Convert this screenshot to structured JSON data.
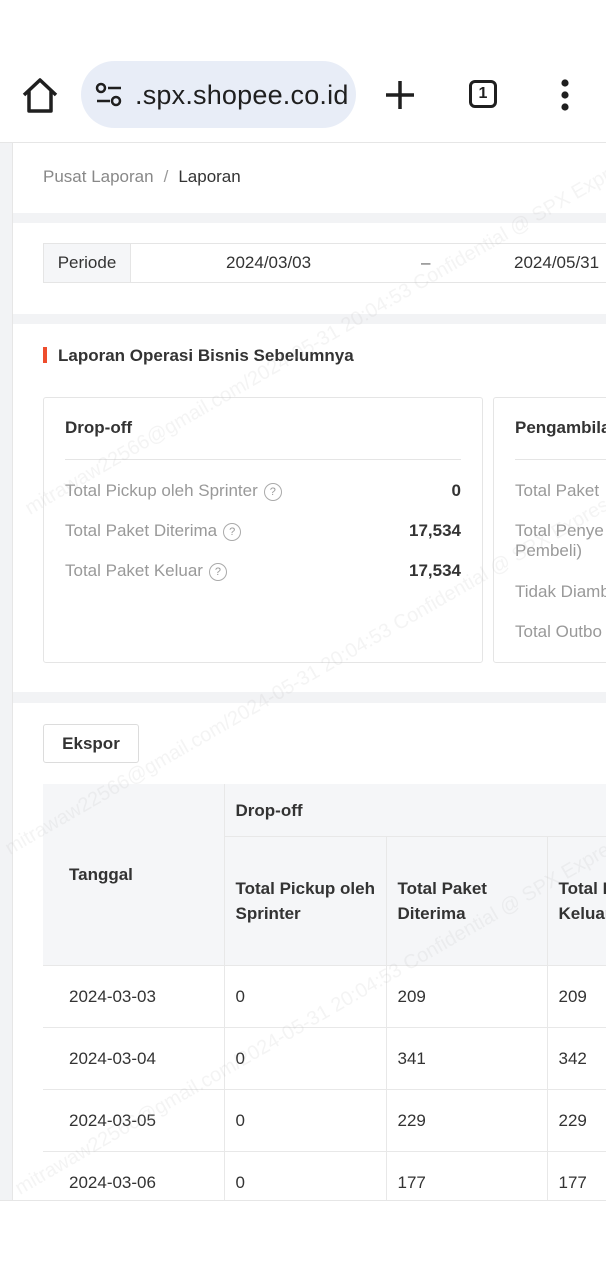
{
  "browser": {
    "url": ".spx.shopee.co.id",
    "tab_count": "1"
  },
  "breadcrumb": {
    "parent": "Pusat Laporan",
    "separator": "/",
    "current": "Laporan"
  },
  "period": {
    "label": "Periode",
    "start": "2024/03/03",
    "dash": "–",
    "end": "2024/05/31"
  },
  "section_title": "Laporan Operasi Bisnis Sebelumnya",
  "dropoff_card": {
    "title": "Drop-off",
    "rows": [
      {
        "label": "Total Pickup oleh Sprinter",
        "value": "0"
      },
      {
        "label": "Total Paket Diterima",
        "value": "17,534"
      },
      {
        "label": "Total Paket Keluar",
        "value": "17,534"
      }
    ]
  },
  "pickup_card": {
    "title": "Pengambila",
    "rows": [
      {
        "label": "Total Paket"
      },
      {
        "label": "Total Penye"
      },
      {
        "label": "Pembeli)"
      },
      {
        "label": "Tidak Diamb"
      },
      {
        "label": "Total Outbo"
      }
    ]
  },
  "export_label": "Ekspor",
  "table": {
    "date_header": "Tanggal",
    "group_header": "Drop-off",
    "col_pickup_line1": "Total Pickup oleh",
    "col_pickup_line2": "Sprinter",
    "col_received_line1": "Total Paket",
    "col_received_line2": "Diterima",
    "col_out_line1": "Total P",
    "col_out_line2": "Keluar",
    "rows": [
      {
        "date": "2024-03-03",
        "pickup": "0",
        "received": "209",
        "out": "209"
      },
      {
        "date": "2024-03-04",
        "pickup": "0",
        "received": "341",
        "out": "342"
      },
      {
        "date": "2024-03-05",
        "pickup": "0",
        "received": "229",
        "out": "229"
      },
      {
        "date": "2024-03-06",
        "pickup": "0",
        "received": "177",
        "out": "177"
      }
    ]
  },
  "watermark": "mitrawaw22566@gmail.com/2024-05-31 20:04:53 Confidential @ SPX Express"
}
